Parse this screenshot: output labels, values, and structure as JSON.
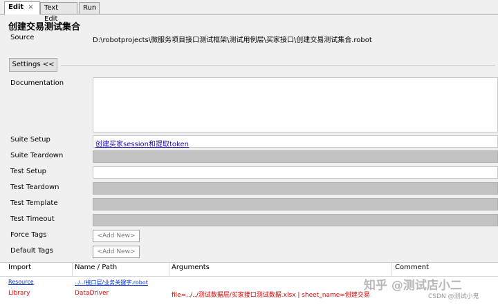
{
  "tabs": [
    {
      "label": "Edit",
      "close": "×"
    },
    {
      "label": "Text Edit"
    },
    {
      "label": "Run"
    }
  ],
  "title": "创建交易测试集合",
  "source": {
    "label": "Source",
    "value": "D:\\robotprojects\\微服务项目接口测试框架\\测试用例层\\买家接口\\创建交易测试集合.robot"
  },
  "settings_button": "Settings <<",
  "fields": {
    "documentation": "Documentation",
    "suite_setup": "Suite Setup",
    "suite_setup_value": "创建买家session和提取token",
    "suite_teardown": "Suite Teardown",
    "test_setup": "Test Setup",
    "test_teardown": "Test Teardown",
    "test_template": "Test Template",
    "test_timeout": "Test Timeout",
    "force_tags": "Force Tags",
    "default_tags": "Default Tags",
    "add_new": "<Add New>"
  },
  "imports": {
    "headers": [
      "Import",
      "Name / Path",
      "Arguments",
      "Comment"
    ],
    "rows": [
      {
        "type": "Resource",
        "name": "../../接口层/业务关键字.robot",
        "args": "",
        "color": "#0033cc"
      },
      {
        "type": "Library",
        "name": "DataDriver",
        "args": "file=../../测试数据层/买家接口测试数据.xlsx | sheet_name=创建交易",
        "color": "#e00000"
      }
    ]
  },
  "watermark": "知乎 @测试店小二",
  "watermark2": "CSDN @测试小鬼"
}
